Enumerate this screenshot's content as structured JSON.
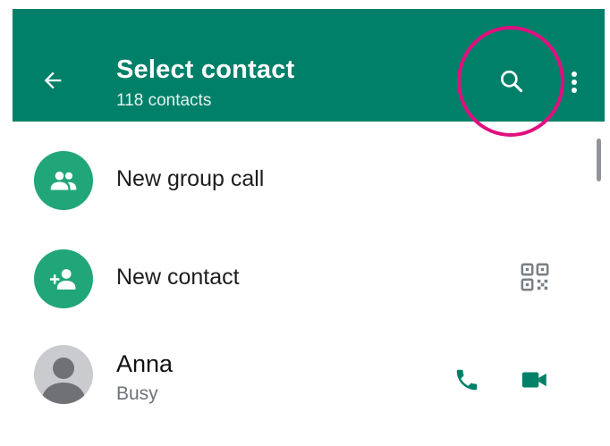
{
  "header": {
    "title": "Select contact",
    "subtitle": "118 contacts",
    "icons": [
      "back-arrow-icon",
      "search-icon",
      "more-vert-icon"
    ]
  },
  "actions": [
    {
      "label": "New group call",
      "icon": "group-icon"
    },
    {
      "label": "New contact",
      "icon": "add-person-icon",
      "trailing_icon": "qr-code-icon"
    }
  ],
  "contacts": [
    {
      "name": "Anna",
      "status": "Busy",
      "avatar": "default-avatar-icon",
      "actions": [
        "phone-icon",
        "video-icon"
      ]
    }
  ],
  "colors": {
    "appbar": "#008069",
    "accent": "#21a67a",
    "highlight": "#e0107f"
  }
}
